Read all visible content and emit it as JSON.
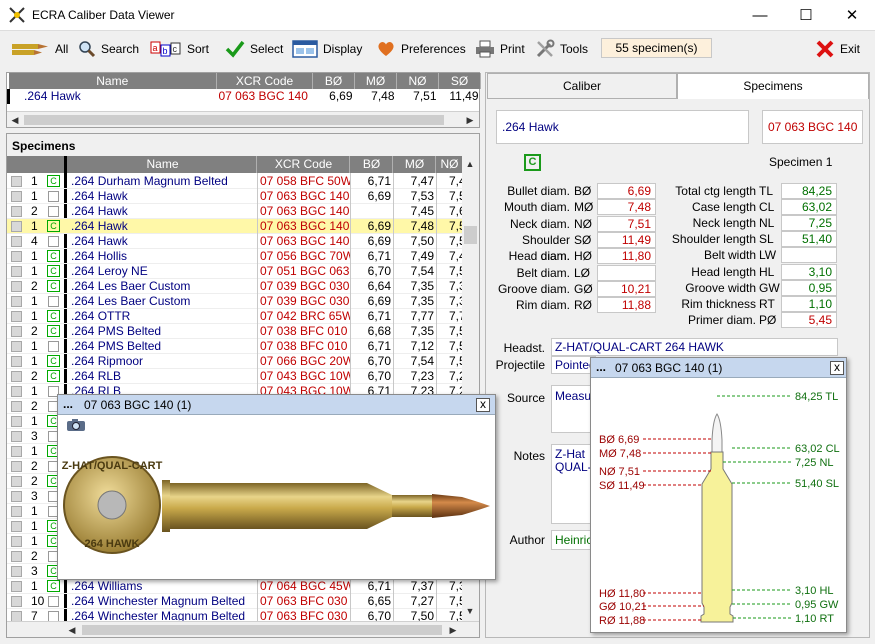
{
  "window": {
    "title": "ECRA Caliber Data Viewer",
    "minimize": "—",
    "maximize": "☐",
    "close": "✕"
  },
  "toolbar": {
    "all": "All",
    "search": "Search",
    "sort": "Sort",
    "select": "Select",
    "display": "Display",
    "preferences": "Preferences",
    "print": "Print",
    "tools": "Tools",
    "count": "55 specimen(s)",
    "exit": "Exit"
  },
  "caliber_grid": {
    "headers": [
      "Name",
      "XCR Code",
      "BØ",
      "MØ",
      "NØ",
      "SØ"
    ],
    "row": [
      "264 Hawk",
      "07 063 BGC 140",
      "6,69",
      "7,48",
      "7,51",
      "11,49"
    ]
  },
  "specimens": {
    "title": "Specimens",
    "headers": [
      "Name",
      "XCR Code",
      "BØ",
      "MØ",
      "NØ"
    ],
    "rows": [
      {
        "n": "1",
        "c": true,
        "name": ".264 Durham Magnum Belted",
        "code": "07 058 BFC 50W",
        "b": "6,71",
        "m": "7,47",
        "x": "7,4"
      },
      {
        "n": "1",
        "c": false,
        "name": ".264 Hawk",
        "code": "07 063 BGC 140",
        "b": "6,69",
        "m": "7,53",
        "x": "7,5"
      },
      {
        "n": "2",
        "c": false,
        "name": ".264 Hawk",
        "code": "07 063 BGC 140",
        "b": "",
        "m": "7,45",
        "x": "7,6"
      },
      {
        "n": "1",
        "c": true,
        "name": ".264 Hawk",
        "code": "07 063 BGC 140",
        "b": "6,69",
        "m": "7,48",
        "x": "7,5",
        "sel": true
      },
      {
        "n": "4",
        "c": false,
        "name": ".264 Hawk",
        "code": "07 063 BGC 140",
        "b": "6,69",
        "m": "7,50",
        "x": "7,5"
      },
      {
        "n": "1",
        "c": true,
        "name": ".264 Hollis",
        "code": "07 056 BGC 70W",
        "b": "6,71",
        "m": "7,49",
        "x": "7,4"
      },
      {
        "n": "1",
        "c": true,
        "name": ".264 Leroy NE",
        "code": "07 051 BGC 063",
        "b": "6,70",
        "m": "7,54",
        "x": "7,5"
      },
      {
        "n": "2",
        "c": true,
        "name": ".264 Les Baer Custom",
        "code": "07 039 BGC 030",
        "b": "6,64",
        "m": "7,35",
        "x": "7,3"
      },
      {
        "n": "1",
        "c": false,
        "name": ".264 Les Baer Custom",
        "code": "07 039 BGC 030",
        "b": "6,69",
        "m": "7,35",
        "x": "7,3"
      },
      {
        "n": "1",
        "c": true,
        "name": ".264 OTTR",
        "code": "07 042 BRC 65W",
        "b": "6,71",
        "m": "7,77",
        "x": "7,7"
      },
      {
        "n": "2",
        "c": true,
        "name": ".264 PMS Belted",
        "code": "07 038 BFC 010",
        "b": "6,68",
        "m": "7,35",
        "x": "7,5"
      },
      {
        "n": "1",
        "c": false,
        "name": ".264 PMS Belted",
        "code": "07 038 BFC 010",
        "b": "6,71",
        "m": "7,12",
        "x": "7,5"
      },
      {
        "n": "1",
        "c": true,
        "name": ".264 Ripmoor",
        "code": "07 066 BGC 20W",
        "b": "6,70",
        "m": "7,54",
        "x": "7,5"
      },
      {
        "n": "2",
        "c": true,
        "name": ".264 RLB",
        "code": "07 043 BGC 10W",
        "b": "6,70",
        "m": "7,23",
        "x": "7,2"
      },
      {
        "n": "1",
        "c": false,
        "name": ".264 RLB",
        "code": "07 043 BGC 10W",
        "b": "6,71",
        "m": "7,23",
        "x": "7,2"
      }
    ],
    "bottom_rows": [
      {
        "n": "1",
        "c": true,
        "name": ".264 Williams",
        "code": "07 064 BGC 45W",
        "b": "6,71",
        "m": "7,37",
        "x": "7,3"
      },
      {
        "n": "10",
        "c": false,
        "name": ".264 Winchester Magnum Belted",
        "code": "07 063 BFC 030",
        "b": "6,65",
        "m": "7,27",
        "x": "7,5"
      },
      {
        "n": "7",
        "c": false,
        "name": ".264 Winchester Magnum Belted",
        "code": "07 063 BFC 030",
        "b": "6,70",
        "m": "7,50",
        "x": "7,5"
      }
    ],
    "hidden_rows": [
      {
        "n": "2",
        "c": false
      },
      {
        "n": "1",
        "c": true
      },
      {
        "n": "3",
        "c": false
      },
      {
        "n": "1",
        "c": true
      },
      {
        "n": "2",
        "c": false
      },
      {
        "n": "2",
        "c": true
      },
      {
        "n": "3",
        "c": false
      },
      {
        "n": "1",
        "c": false
      },
      {
        "n": "1",
        "c": true
      },
      {
        "n": "1",
        "c": true
      },
      {
        "n": "2",
        "c": false
      },
      {
        "n": "3",
        "c": true
      }
    ]
  },
  "tabs": {
    "caliber": "Caliber",
    "specimens": "Specimens"
  },
  "detail": {
    "name": ".264 Hawk",
    "code": "07 063 BGC 140",
    "badge": "C",
    "specimen": "Specimen 1",
    "left_fields": [
      {
        "label": "Bullet diam.",
        "sym": "BØ",
        "value": "6,69"
      },
      {
        "label": "Mouth diam.",
        "sym": "MØ",
        "value": "7,48"
      },
      {
        "label": "Neck diam.",
        "sym": "NØ",
        "value": "7,51"
      },
      {
        "label": "Shoulder diam.",
        "sym": "SØ",
        "value": "11,49"
      },
      {
        "label": "Head diam.",
        "sym": "HØ",
        "value": "11,80"
      },
      {
        "label": "Belt diam.",
        "sym": "LØ",
        "value": ""
      },
      {
        "label": "Groove diam.",
        "sym": "GØ",
        "value": "10,21"
      },
      {
        "label": "Rim diam.",
        "sym": "RØ",
        "value": "11,88"
      }
    ],
    "right_fields": [
      {
        "label": "Total ctg length",
        "sym": "TL",
        "value": "84,25"
      },
      {
        "label": "Case length",
        "sym": "CL",
        "value": "63,02"
      },
      {
        "label": "Neck length",
        "sym": "NL",
        "value": "7,25"
      },
      {
        "label": "Shoulder length",
        "sym": "SL",
        "value": "51,40"
      },
      {
        "label": "Belt width",
        "sym": "LW",
        "value": ""
      },
      {
        "label": "Head length",
        "sym": "HL",
        "value": "3,10"
      },
      {
        "label": "Groove width",
        "sym": "GW",
        "value": "0,95"
      },
      {
        "label": "Rim thickness",
        "sym": "RT",
        "value": "1,10"
      },
      {
        "label": "Primer diam.",
        "sym": "PØ",
        "value": "5,45"
      }
    ],
    "headst_label": "Headst.",
    "headst_value": "Z-HAT/QUAL-CART  264 HAWK",
    "projectile_label": "Projectile",
    "projectile_value": "Pointed",
    "source_label": "Source",
    "source_value": "Measu",
    "notes_label": "Notes",
    "notes_value_1": "Z-Hat",
    "notes_value_2": "QUAL-",
    "author_label": "Author",
    "author_value": "Heinric"
  },
  "photo_popup": {
    "title": "07 063 BGC 140  (1)",
    "headstamp_top": "Z-HAT/QUAL-CART",
    "headstamp_bottom": "264 HAWK",
    "close": "x"
  },
  "drawing_popup": {
    "title": "07 063 BGC 140  (1)",
    "close": "x",
    "left_labels": [
      "BØ 6,69",
      "MØ 7,48",
      "NØ 7,51",
      "SØ 11,49",
      "HØ 11,80",
      "GØ 10,21",
      "RØ 11,88"
    ],
    "right_labels": [
      "84,25 TL",
      "63,02 CL",
      "7,25 NL",
      "51,40 SL",
      "3,10 HL",
      "0,95 GW",
      "1,10 RT"
    ]
  }
}
